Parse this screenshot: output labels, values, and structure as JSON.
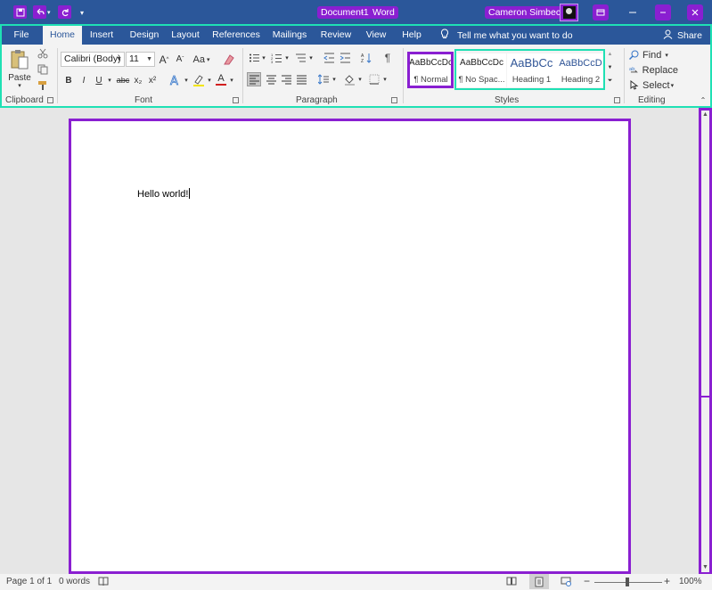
{
  "window": {
    "doc_name": "Document1",
    "separator": "-",
    "app_name": "Word",
    "user_name": "Cameron Simbeck"
  },
  "qat": {
    "save_icon": "save-icon",
    "undo_icon": "undo-icon",
    "redo_icon": "redo-icon",
    "customize_icon": "customize-qat-icon"
  },
  "tabs": [
    {
      "label": "File"
    },
    {
      "label": "Home"
    },
    {
      "label": "Insert"
    },
    {
      "label": "Design"
    },
    {
      "label": "Layout"
    },
    {
      "label": "References"
    },
    {
      "label": "Mailings"
    },
    {
      "label": "Review"
    },
    {
      "label": "View"
    },
    {
      "label": "Help"
    }
  ],
  "tell_me": "Tell me what you want to do",
  "share_label": "Share",
  "clipboard": {
    "paste_label": "Paste",
    "group_label": "Clipboard"
  },
  "font": {
    "family": "Calibri (Body)",
    "size": "11",
    "case_label": "Aa",
    "bold": "B",
    "italic": "I",
    "underline": "U",
    "strike": "abc",
    "subscript": "x₂",
    "superscript": "x²",
    "font_color": "A",
    "group_label": "Font"
  },
  "paragraph": {
    "group_label": "Paragraph"
  },
  "styles": {
    "items": [
      {
        "preview": "AaBbCcDc",
        "name": "¶ Normal"
      },
      {
        "preview": "AaBbCcDc",
        "name": "¶ No Spac..."
      },
      {
        "preview": "AaBbCc",
        "name": "Heading 1"
      },
      {
        "preview": "AaBbCcD",
        "name": "Heading 2"
      }
    ],
    "group_label": "Styles"
  },
  "editing": {
    "find": "Find",
    "replace": "Replace",
    "select": "Select",
    "group_label": "Editing"
  },
  "document": {
    "text": "Hello world!"
  },
  "status": {
    "page": "Page 1 of 1",
    "words": "0 words",
    "zoom": "100%",
    "zoom_minus": "−",
    "zoom_plus": "+"
  },
  "colors": {
    "title_bar": "#2b579a",
    "highlight_purple": "#8a1fd1",
    "highlight_teal": "#1fe0b4"
  }
}
